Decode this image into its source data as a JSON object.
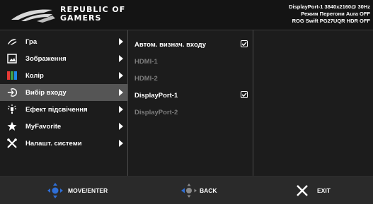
{
  "header": {
    "brand_line1": "REPUBLIC OF",
    "brand_line2": "GAMERS",
    "status_line1": "DisplayPort-1  3840x2160@ 30Hz",
    "status_line2": "Режим Перегони   Aura OFF",
    "status_line3": "ROG Swift PG27UQR HDR OFF"
  },
  "menu": {
    "items": [
      {
        "label": "Гра",
        "icon": "rog-eye-icon"
      },
      {
        "label": "Зображення",
        "icon": "image-icon"
      },
      {
        "label": "Колір",
        "icon": "color-bars-icon"
      },
      {
        "label": "Вибір входу",
        "icon": "input-select-icon"
      },
      {
        "label": "Ефект підсвічення",
        "icon": "light-effect-icon"
      },
      {
        "label": "MyFavorite",
        "icon": "star-icon"
      },
      {
        "label": "Налашт. системи",
        "icon": "tools-icon"
      }
    ],
    "active_index": 3
  },
  "submenu": {
    "items": [
      {
        "label": "Автом. визнач. входу",
        "checked": true,
        "enabled": true
      },
      {
        "label": "HDMI-1",
        "checked": false,
        "enabled": false
      },
      {
        "label": "HDMI-2",
        "checked": false,
        "enabled": false
      },
      {
        "label": "DisplayPort-1",
        "checked": true,
        "enabled": true
      },
      {
        "label": "DisplayPort-2",
        "checked": false,
        "enabled": false
      }
    ]
  },
  "footer": {
    "move_label": "MOVE/ENTER",
    "back_label": "BACK",
    "exit_label": "EXIT"
  },
  "colors": {
    "joystick_blue": "#2f6fd6",
    "active_row": "#555555",
    "disabled_text": "#7c7c7c"
  }
}
